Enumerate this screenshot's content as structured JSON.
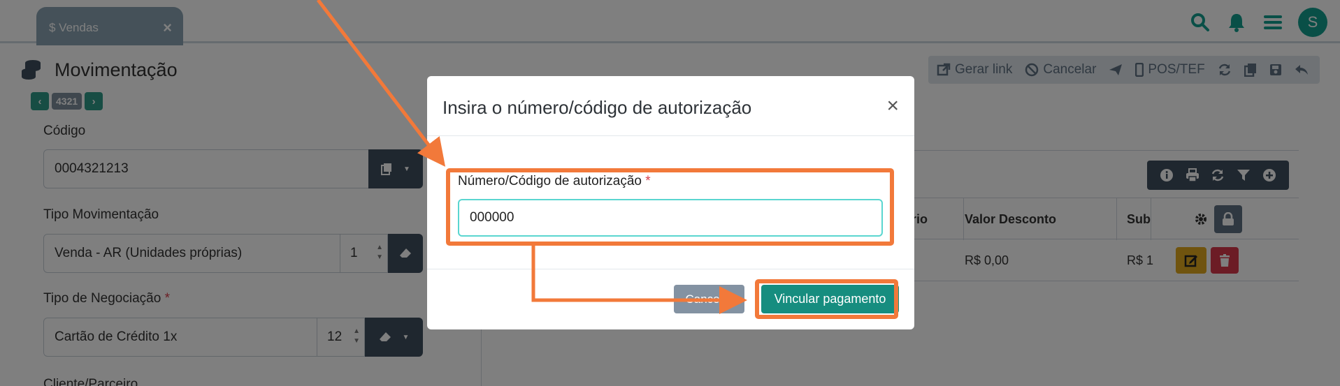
{
  "tab": {
    "label": "$ Vendas",
    "close": "×"
  },
  "header_icons": [
    "search-icon",
    "bell-icon",
    "menu-icon"
  ],
  "avatar": "S",
  "page": {
    "title": "Movimentação",
    "record_number": "4321"
  },
  "toolbar": {
    "generate_link": "Gerar link",
    "cancel": "Cancelar",
    "pos_tef": "POS/TEF"
  },
  "form": {
    "codigo": {
      "label": "Código",
      "value": "0004321213"
    },
    "tipo_movimentacao": {
      "label": "Tipo Movimentação",
      "value": "Venda - AR (Unidades próprias)",
      "number": "1"
    },
    "tipo_negociacao": {
      "label": "Tipo de Negociação",
      "required": "*",
      "value": "Cartão de Crédito 1x",
      "number": "12"
    },
    "cliente": {
      "label": "Cliente/Parceiro"
    }
  },
  "table": {
    "headers": {
      "partial": "rio",
      "discount": "Valor Desconto",
      "sub": "Sub"
    },
    "row": {
      "discount": "R$ 0,00",
      "sub": "R$ 1"
    }
  },
  "modal": {
    "title": "Insira o número/código de autorização",
    "close": "×",
    "field_label": "Número/Código de autorização",
    "required": "*",
    "field_value": "000000",
    "cancel_label": "Cancelar",
    "submit_label": "Vincular pagamento"
  },
  "colors": {
    "primary": "#168d7f",
    "annotation": "#f2793a",
    "required": "#d63c4a"
  }
}
